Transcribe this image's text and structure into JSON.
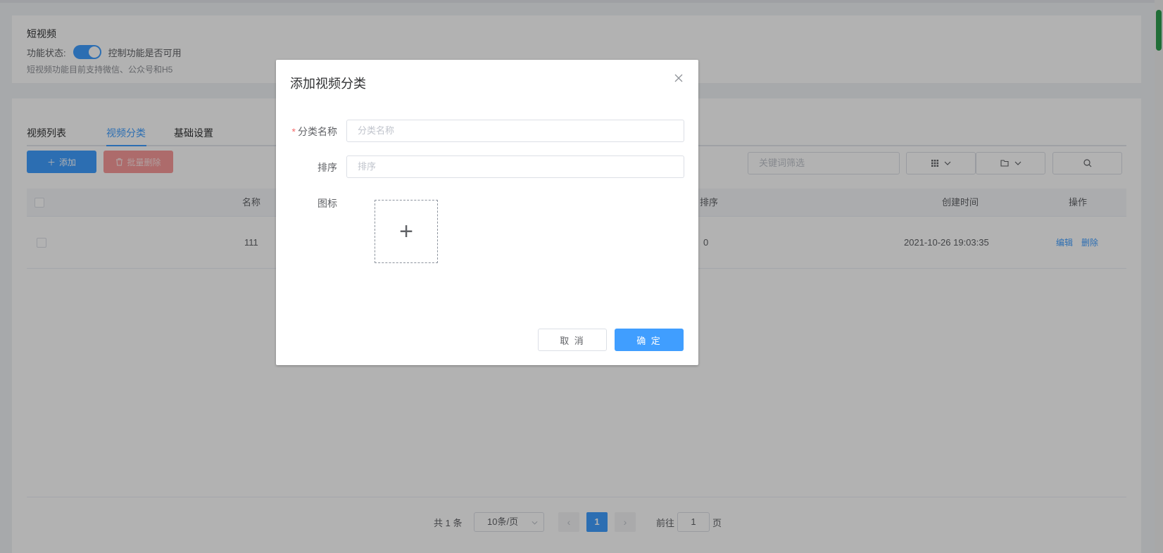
{
  "feature": {
    "title": "短视频",
    "status_label": "功能状态:",
    "toggle_on": true,
    "toggle_label": "控制功能是否可用",
    "description": "短视频功能目前支持微信、公众号和H5"
  },
  "tabs": [
    {
      "label": "视频列表",
      "active": false
    },
    {
      "label": "视频分类",
      "active": true
    },
    {
      "label": "基础设置",
      "active": false
    }
  ],
  "toolbar": {
    "add_label": "添加",
    "batch_delete_label": "批量删除",
    "filter_placeholder": "关键词筛选"
  },
  "table": {
    "columns": [
      "名称",
      "排序",
      "创建时间",
      "操作"
    ],
    "rows": [
      {
        "name": "111",
        "sort": "0",
        "created": "2021-10-26 19:03:35",
        "actions": [
          "编辑",
          "删除"
        ]
      }
    ]
  },
  "pagination": {
    "total_text": "共 1 条",
    "page_size": "10条/页",
    "current_page": "1",
    "goto_label": "前往",
    "goto_value": "1",
    "page_suffix": "页"
  },
  "dialog": {
    "title": "添加视频分类",
    "fields": {
      "name_label": "分类名称",
      "name_placeholder": "分类名称",
      "sort_label": "排序",
      "sort_placeholder": "排序",
      "icon_label": "图标"
    },
    "cancel_label": "取 消",
    "ok_label": "确 定"
  },
  "colors": {
    "primary": "#409eff",
    "danger": "#f56c6c"
  }
}
